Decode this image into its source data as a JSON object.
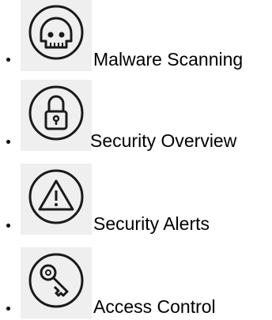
{
  "menu": {
    "items": [
      {
        "label": "Malware Scanning",
        "icon": "skull-icon"
      },
      {
        "label": "Security Overview",
        "icon": "padlock-icon"
      },
      {
        "label": "Security Alerts",
        "icon": "warning-triangle-icon"
      },
      {
        "label": "Access Control",
        "icon": "key-icon"
      }
    ]
  }
}
